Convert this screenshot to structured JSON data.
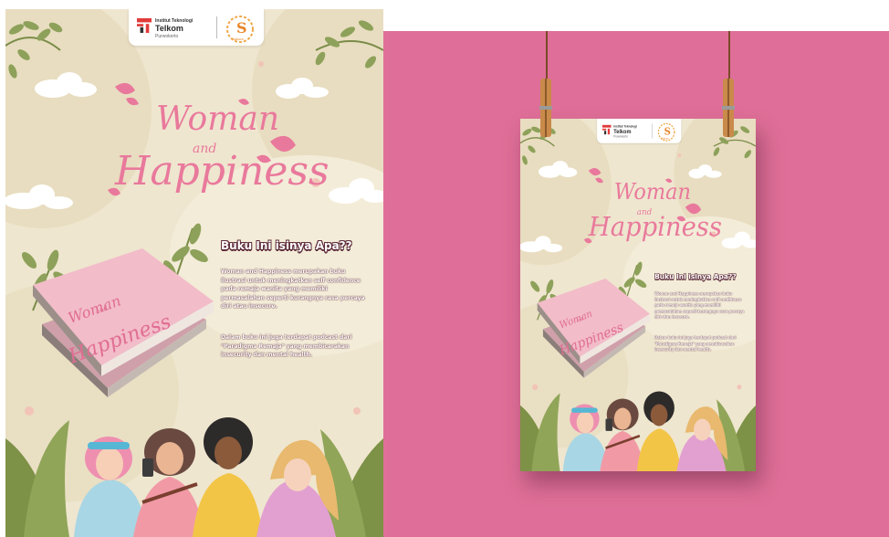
{
  "poster": {
    "logo": {
      "institute_line1": "Institut Teknologi",
      "institute_line2": "Telkom",
      "institute_line3": "Purwokerto",
      "partner_letter": "S",
      "partner_name": "Sakura"
    },
    "title": {
      "word1": "Woman",
      "word2": "and",
      "word3": "Happiness"
    },
    "heading": "Buku Ini isinya Apa??",
    "paragraph1": "Woman and Happiness merupakan buku ilustrasi untuk meningkatkan self confidence pada remaja wanita yang memiliki permasalahan seperti kurangnya rasa percaya diri atau insecure.",
    "paragraph2": "Dalam buku ini juga terdapat podcast dari \"Paradigma Remaja\" yang membicarakan insecurity dan mental health.",
    "book_cover": {
      "word1": "Woman",
      "word2": "and",
      "word3": "Happiness"
    }
  },
  "colors": {
    "wall": "#df6f98",
    "poster_bg": "#efe6cf",
    "title_pink": "#e9799c",
    "leaf_green": "#8ea15a",
    "clip_wood": "#c98a4a"
  },
  "icons": [
    "telkom-logo-icon",
    "sakura-logo-icon",
    "leaf-branch-icon",
    "cloud-icon",
    "petal-icon",
    "clothespin-icon"
  ]
}
